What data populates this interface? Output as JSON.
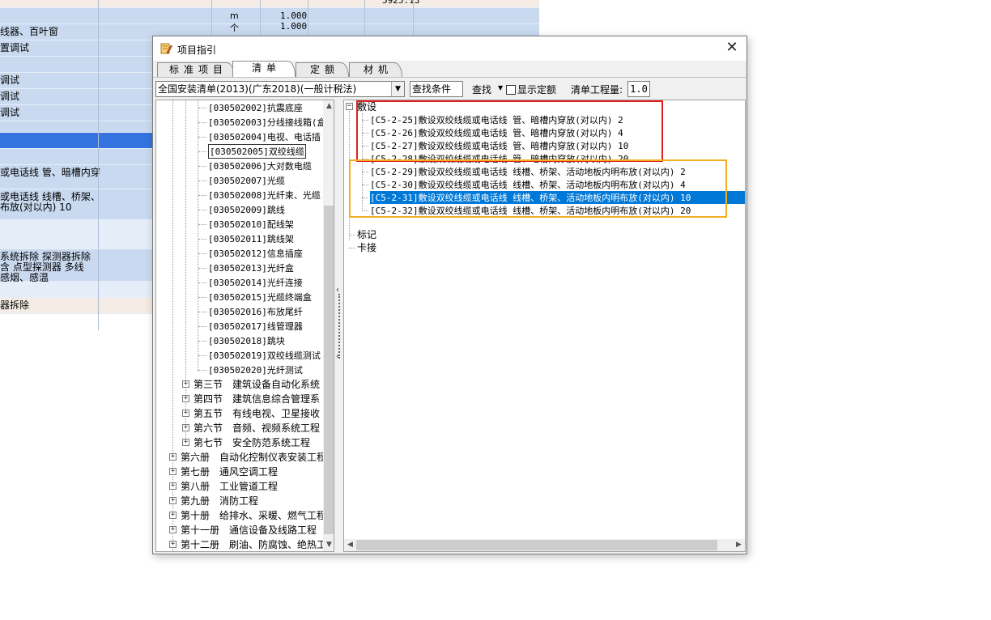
{
  "background_sheet": {
    "rows": [
      {
        "text": "",
        "unit": "",
        "qty": "5925.13",
        "style": "peach"
      },
      {
        "text": "",
        "unit": "m",
        "qty": "1.000",
        "style": "blue"
      },
      {
        "text": "线器、百叶窗",
        "unit": "个",
        "qty": "1.000",
        "style": "blue"
      },
      {
        "text": "置调试",
        "unit": "",
        "qty": "",
        "style": "blue"
      },
      {
        "text": "",
        "unit": "",
        "qty": "",
        "style": "blue"
      },
      {
        "text": "调试",
        "unit": "",
        "qty": "",
        "style": "blue"
      },
      {
        "text": "调试",
        "unit": "",
        "qty": "",
        "style": "blue"
      },
      {
        "text": "调试",
        "unit": "",
        "qty": "",
        "style": "blue"
      },
      {
        "text": "",
        "unit": "",
        "qty": "",
        "style": "blue"
      },
      {
        "text": "",
        "unit": "",
        "qty": "",
        "style": "sel"
      },
      {
        "text": "",
        "unit": "",
        "qty": "",
        "style": "blue"
      },
      {
        "text": "或电话线 管、暗槽内穿",
        "unit": "",
        "qty": "",
        "style": "blue"
      },
      {
        "text": "或电话线 线槽、桥架、\n布放(对以内) 10",
        "unit": "",
        "qty": "",
        "style": "blue"
      },
      {
        "text": "",
        "unit": "",
        "qty": "",
        "style": "light"
      },
      {
        "text": "系统拆除 探测器拆除\n含 点型探测器 多线\n感烟、感温",
        "unit": "",
        "qty": "",
        "style": "blue"
      },
      {
        "text": "",
        "unit": "",
        "qty": "",
        "style": "light"
      },
      {
        "text": "器拆除",
        "unit": "",
        "qty": "",
        "style": "peach"
      }
    ]
  },
  "dialog": {
    "title": "项目指引",
    "close_symbol": "✕",
    "tabs": [
      {
        "label": "标准项目",
        "active": false
      },
      {
        "label": "清单",
        "active": true
      },
      {
        "label": "定额",
        "active": false
      },
      {
        "label": "材机",
        "active": false
      }
    ],
    "toolbar": {
      "library_value": "全国安装清单(2013)(广东2018)(一般计税法)",
      "condition_label": "查找条件",
      "find_label": "查找",
      "find_arrow": "▼",
      "show_quota_label": "显示定额",
      "show_quota_checked": false,
      "qty_label": "清单工程量:",
      "qty_value": "1.0"
    },
    "left_tree": {
      "items": [
        "[030502002]抗震底座",
        "[030502003]分线接线箱(盒",
        "[030502004]电视、电话插",
        "[030502005]双绞线缆",
        "[030502006]大对数电缆",
        "[030502007]光缆",
        "[030502008]光纤束、光缆",
        "[030502009]跳线",
        "[030502010]配线架",
        "[030502011]跳线架",
        "[030502012]信息插座",
        "[030502013]光纤盒",
        "[030502014]光纤连接",
        "[030502015]光缆终端盒",
        "[030502016]布放尾纤",
        "[030502017]线管理器",
        "[030502018]跳块",
        "[030502019]双绞线缆测试",
        "[030502020]光纤测试"
      ],
      "sections": [
        "第三节　建筑设备自动化系统",
        "第四节　建筑信息综合管理系",
        "第五节　有线电视、卫星接收",
        "第六节　音频、视频系统工程",
        "第七节　安全防范系统工程"
      ],
      "volumes": [
        "第六册　自动化控制仪表安装工程",
        "第七册　通风空调工程",
        "第八册　工业管道工程",
        "第九册　消防工程",
        "第十册　给排水、采暖、燃气工程",
        "第十一册　通信设备及线路工程",
        "第十二册　刷油、防腐蚀、绝热工程"
      ],
      "expand_symbol": "+",
      "selected_index": 3
    },
    "right_tree": {
      "root_label": "敷设",
      "collapse_symbol": "−",
      "items": [
        "[C5-2-25]敷设双绞线缆或电话线 管、暗槽内穿放(对以内) 2",
        "[C5-2-26]敷设双绞线缆或电话线 管、暗槽内穿放(对以内) 4",
        "[C5-2-27]敷设双绞线缆或电话线 管、暗槽内穿放(对以内) 10",
        "[C5-2-28]敷设双绞线缆或电话线 管、暗槽内穿放(对以内) 20",
        "[C5-2-29]敷设双绞线缆或电话线 线槽、桥架、活动地板内明布放(对以内) 2",
        "[C5-2-30]敷设双绞线缆或电话线 线槽、桥架、活动地板内明布放(对以内) 4",
        "[C5-2-31]敷设双绞线缆或电话线 线槽、桥架、活动地板内明布放(对以内) 10",
        "[C5-2-32]敷设双绞线缆或电话线 线槽、桥架、活动地板内明布放(对以内) 20"
      ],
      "selected_index": 6,
      "other_nodes": [
        "标记",
        "卡接"
      ]
    },
    "colors": {
      "selection": "#0078d7",
      "highlight_red": "#e02020",
      "highlight_orange": "#f0b020",
      "sheet_blue": "#c9daf0",
      "sheet_selected": "#3573e0"
    }
  }
}
